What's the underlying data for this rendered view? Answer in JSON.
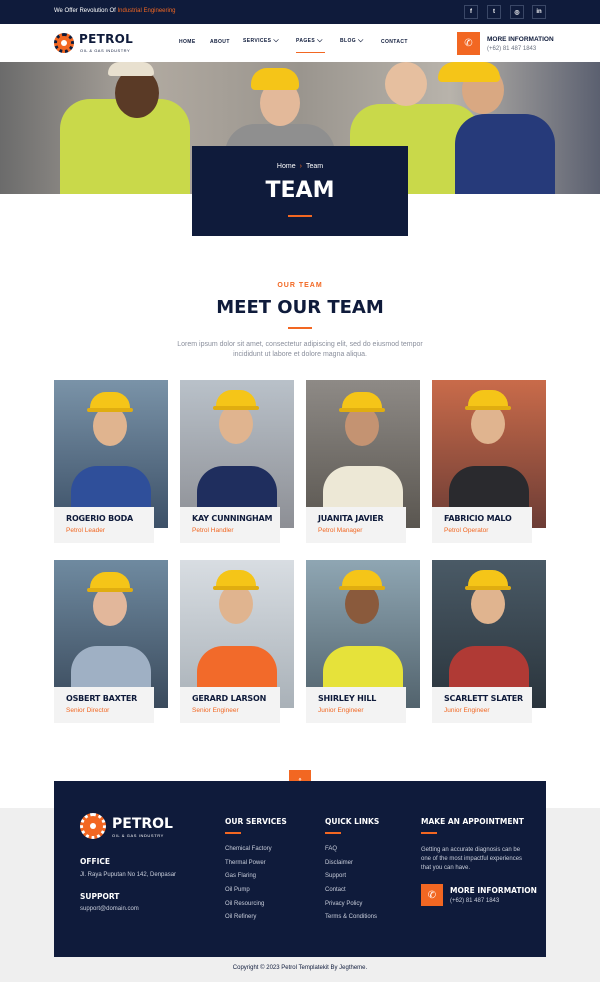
{
  "topbar": {
    "message": "We Offer Revolution Of",
    "message_highlight": "Industrial Engineering",
    "socials": [
      {
        "icon": "facebook-icon",
        "glyph": "f"
      },
      {
        "icon": "twitter-icon",
        "glyph": "t"
      },
      {
        "icon": "instagram-icon",
        "glyph": "◎"
      },
      {
        "icon": "linkedin-icon",
        "glyph": "in"
      }
    ]
  },
  "brand": {
    "name": "PETROL",
    "tagline": "OIL & GAS INDUSTRY",
    "accent": "#f26722",
    "navy": "#0f1b3b"
  },
  "nav": {
    "items": [
      {
        "label": "HOME",
        "dropdown": false
      },
      {
        "label": "ABOUT",
        "dropdown": false
      },
      {
        "label": "SERVICES",
        "dropdown": true
      },
      {
        "label": "PAGES",
        "dropdown": true,
        "active": true
      },
      {
        "label": "BLOG",
        "dropdown": true
      },
      {
        "label": "CONTACT",
        "dropdown": false
      }
    ]
  },
  "header_info": {
    "title": "MORE INFORMATION",
    "phone": "(+62) 81 487 1843"
  },
  "hero": {
    "breadcrumb_home": "Home",
    "breadcrumb_current": "Team",
    "title": "TEAM"
  },
  "team_section": {
    "eyebrow": "OUR TEAM",
    "title": "MEET OUR TEAM",
    "description": "Lorem ipsum dolor sit amet, consectetur adipiscing elit, sed do eiusmod tempor incididunt ut labore et dolore magna aliqua.",
    "members": [
      {
        "name": "ROGERIO BODA",
        "role": "Petrol Leader"
      },
      {
        "name": "KAY CUNNINGHAM",
        "role": "Petrol Handler"
      },
      {
        "name": "JUANITA JAVIER",
        "role": "Petrol Manager"
      },
      {
        "name": "FABRICIO MALO",
        "role": "Petrol Operator"
      },
      {
        "name": "OSBERT BAXTER",
        "role": "Senior Director"
      },
      {
        "name": "GERARD LARSON",
        "role": "Senior Engineer"
      },
      {
        "name": "SHIRLEY HILL",
        "role": "Junior Engineer"
      },
      {
        "name": "SCARLETT SLATER",
        "role": "Junior Engineer"
      }
    ]
  },
  "footer": {
    "office_title": "OFFICE",
    "office_address": "Jl. Raya Puputan No 142, Denpasar",
    "support_title": "SUPPORT",
    "support_email": "support@domain.com",
    "services_title": "OUR SERVICES",
    "services": [
      "Chemical Factory",
      "Thermal Power",
      "Gas Flaring",
      "Oil Pump",
      "Oil Resourcing",
      "Oil Refinery"
    ],
    "links_title": "QUICK LINKS",
    "links": [
      "FAQ",
      "Disclaimer",
      "Support",
      "Contact",
      "Privacy Policy",
      "Terms & Conditions"
    ],
    "appointment_title": "MAKE AN APPOINTMENT",
    "appointment_desc": "Getting an accurate diagnosis can be one of the most impactful experiences that you can have.",
    "info_title": "MORE INFORMATION",
    "info_phone": "(+62) 81 487 1843",
    "copyright": "Copyright © 2023 Petrol Templatekit By Jegtheme."
  }
}
